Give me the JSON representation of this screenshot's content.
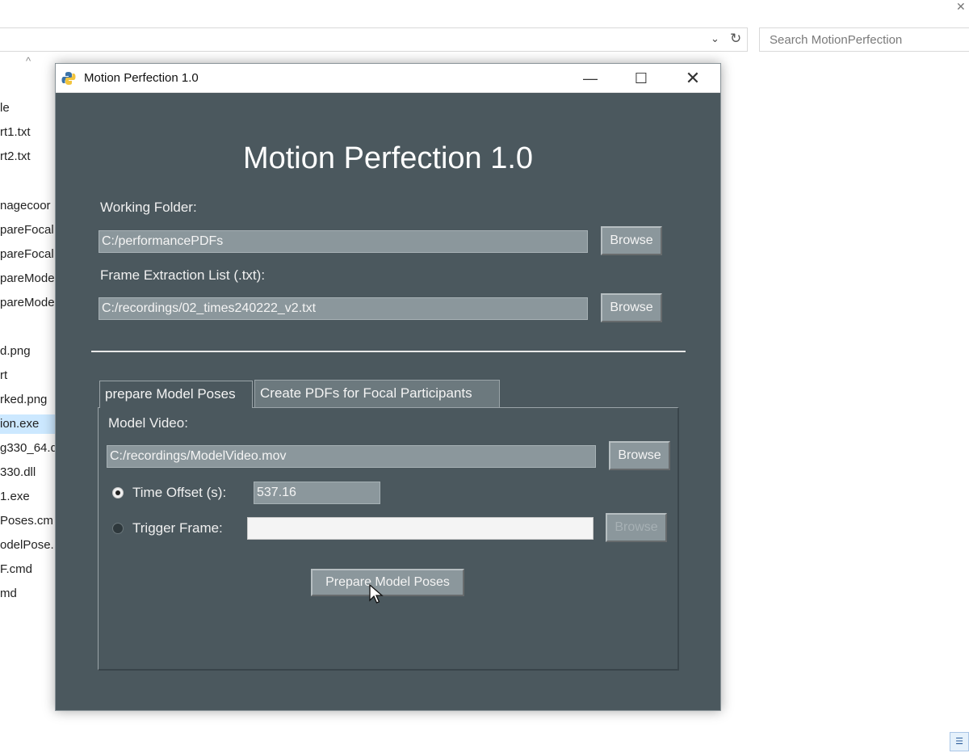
{
  "explorer": {
    "search_placeholder": "Search MotionPerfection",
    "files": [
      "le",
      "rt1.txt",
      "rt2.txt",
      "nagecoor",
      "pareFocal",
      "pareFocal",
      "pareMode",
      "pareMode",
      "d.png",
      "rt",
      "rked.png",
      "ion.exe",
      "g330_64.d",
      "330.dll",
      "1.exe",
      "Poses.cm",
      "odelPose.",
      "F.cmd",
      "md"
    ]
  },
  "window": {
    "title": "Motion Perfection 1.0",
    "heading": "Motion Perfection 1.0"
  },
  "working_folder": {
    "label": "Working Folder:",
    "value": "C:/performancePDFs",
    "browse": "Browse"
  },
  "frame_list": {
    "label": "Frame Extraction List (.txt):",
    "value": "C:/recordings/02_times240222_v2.txt",
    "browse": "Browse"
  },
  "tabs": [
    "prepare Model Poses",
    "Create PDFs for Focal Participants"
  ],
  "model_tab": {
    "video_label": "Model Video:",
    "video_value": "C:/recordings/ModelVideo.mov",
    "video_browse": "Browse",
    "time_offset_label": "Time Offset (s):",
    "time_offset_value": "537.16",
    "trigger_frame_label": "Trigger Frame:",
    "trigger_frame_value": "",
    "trigger_browse": "Browse",
    "prepare_button": "Prepare Model Poses",
    "selected_option": "Time Offset (s):"
  }
}
